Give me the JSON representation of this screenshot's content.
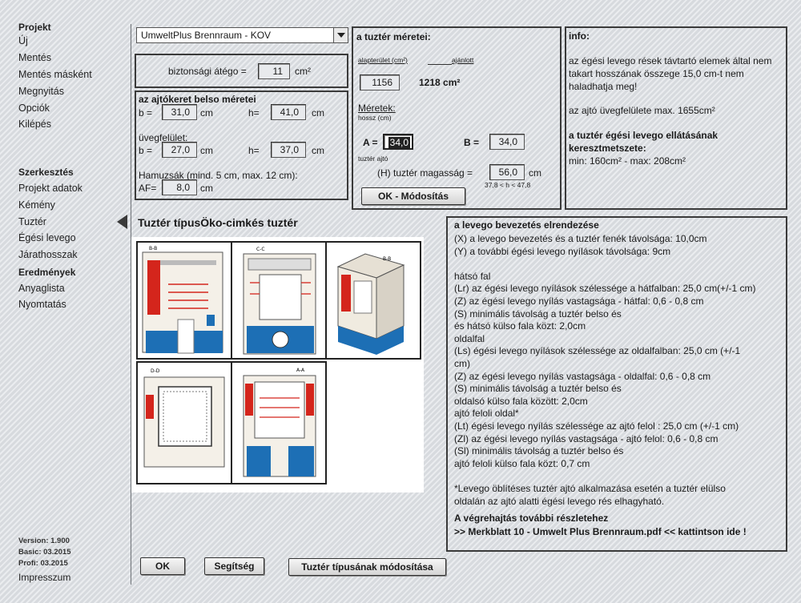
{
  "sidebar": {
    "sections": [
      {
        "heading": "Projekt",
        "items": [
          "Új",
          "Mentés",
          "Mentés másként",
          "Megnyitás",
          "Opciók",
          "Kilépés"
        ]
      },
      {
        "heading": "Szerkesztés",
        "items": [
          "Projekt adatok",
          "Kémény",
          "Tuztér",
          "Égési levego",
          "Járathosszak"
        ]
      },
      {
        "heading": "Eredmények",
        "items": [
          "Anyaglista",
          "Nyomtatás"
        ]
      }
    ],
    "version": {
      "version": "Version: 1.900",
      "basic": "Basic: 03.2015",
      "profi": "Profi: 03.2015"
    },
    "impresszum": "Impresszum"
  },
  "project_select": {
    "value": "UmweltPlus Brennraum - KOV"
  },
  "safety": {
    "label": "biztonsági átégo =",
    "value": "11",
    "unit": "cm²"
  },
  "door_frame": {
    "title": "az ajtókeret belso méretei",
    "b_label": "b =",
    "b_value": "31,0",
    "b_unit": "cm",
    "h_label": "h=",
    "h_value": "41,0",
    "h_unit": "cm",
    "glass_title": "üvegfelület:",
    "gb_label": "b =",
    "gb_value": "27,0",
    "gb_unit": "cm",
    "gh_label": "h=",
    "gh_value": "37,0",
    "gh_unit": "cm",
    "ash_label": "Hamuzsák (mind. 5 cm, max. 12 cm):",
    "af_label": "AF=",
    "af_value": "8,0",
    "af_unit": "cm"
  },
  "firebox": {
    "title": "a tuztér méretei:",
    "area_label": "alapterület (cm²)",
    "recommended_label": "ajánlott",
    "area_value": "1156",
    "recommended_value": "1218 cm²",
    "dims_title": "Méretek:",
    "length_label": "hossz (cm)",
    "a_label": "A =",
    "a_value": "34,0",
    "b_label": "B =",
    "b_value": "34,0",
    "door_label": "tuztér ajtó",
    "height_label": "(H) tuztér magasság =",
    "height_value": "56,0",
    "height_unit": "cm",
    "range_hint": "37,8 < h < 47,8",
    "modify_button": "OK - Módosítás"
  },
  "info": {
    "title": "info:",
    "p1": [
      "az égési levego rések távtartó elemek által nem",
      "takart hosszának összege 15,0 cm-t nem",
      "haladhatja meg!"
    ],
    "p2": "az ajtó üvegfelülete max. 1655cm²",
    "p3_title": [
      "a tuztér égési levego ellátásának",
      "keresztmetszete:"
    ],
    "p3": "min: 160cm² - max: 208cm²"
  },
  "firebox_type_title": "Tuztér típusÖko-cimkés tuztér",
  "drawings": [
    "B-B",
    "C-C",
    "B-B",
    "D-D",
    "A-A"
  ],
  "description": {
    "title": "a levego bevezetés elrendezése",
    "lines": [
      "(X) a levego bevezetés és a tuztér fenék távolsága: 10,0cm",
      "(Y) a további égési levego nyílások távolsága: 9cm",
      "",
      "hátsó fal",
      "(Lr) az égési levego nyílások szélessége a hátfalban: 25,0 cm(+/-1 cm)",
      "(Z) az égési levego nyílás vastagsága - hátfal: 0,6 - 0,8 cm",
      "(S) minimális távolság a tuztér belso és",
      "és hátsó külso fala közt: 2,0cm",
      "oldalfal",
      "(Ls) égési levego nyílások szélessége az oldalfalban: 25,0 cm (+/-1",
      "cm)",
      "(Z) az égési levego nyílás vastagsága - oldalfal: 0,6 - 0,8 cm",
      "(S) minimális távolság a tuztér belso és",
      "oldalsó külso fala között: 2,0cm",
      "ajtó feloli oldal*",
      "(Lt)  égési levego nyílás szélessége az ajtó felol : 25,0 cm (+/-1 cm)",
      "(Zl) az égési levego nyílás vastagsága - ajtó felol: 0,6 - 0,8 cm",
      "(Sl) minimális távolság a tuztér belso és",
      "ajtó feloli külso fala közt: 0,7 cm",
      "",
      "*Levego öblítéses tuztér ajtó alkalmazása esetén a tuztér elülso",
      "oldalán az ajtó alatti égési levego rés elhagyható."
    ],
    "footer_title": "A végrehajtás további részletehez",
    "footer_link": ">> Merkblatt 10 - Umwelt Plus Brennraum.pdf << kattintson ide !"
  },
  "buttons": {
    "ok": "OK",
    "help": "Segítség",
    "change_type": "Tuztér típusának módosítása"
  },
  "colors": {
    "red": "#d4251c",
    "blue": "#1d6fb5",
    "border": "#3a3a3a"
  }
}
